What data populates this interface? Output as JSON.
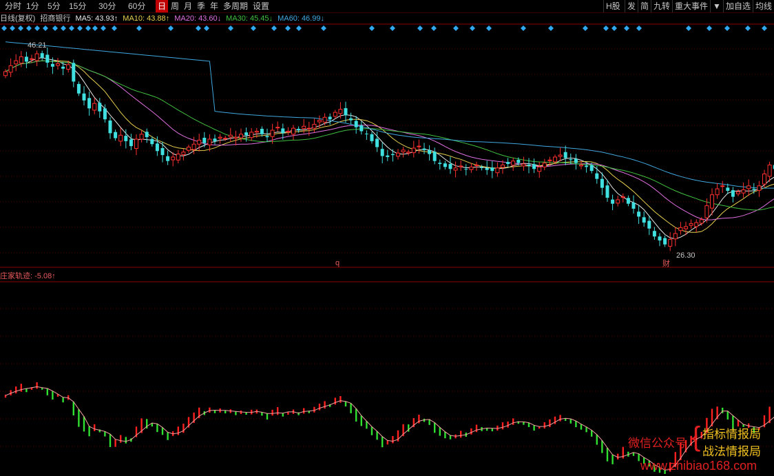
{
  "toolbar": {
    "period_buttons": [
      "分时",
      "1分",
      "5分",
      "15分",
      "30分",
      "60分",
      "日",
      "周",
      "月",
      "季",
      "年",
      "多周期",
      "设置"
    ],
    "active_period": "日",
    "right_buttons": [
      "H股",
      "发",
      "简",
      "九转",
      "重大事件",
      "▼",
      "加自选",
      "均线"
    ]
  },
  "info": {
    "period_label": "日线(复权)",
    "stock_name": "招商银行",
    "ma": [
      {
        "label": "MA5: 43.93↑",
        "color": "#e8e8e8"
      },
      {
        "label": "MA10: 43.88↑",
        "color": "#e8d050"
      },
      {
        "label": "MA20: 43.60↓",
        "color": "#e070e0"
      },
      {
        "label": "MA30: 45.45↓",
        "color": "#40c040"
      },
      {
        "label": "MA60: 46.99↓",
        "color": "#40a8e0"
      }
    ]
  },
  "indicator": {
    "label": "庄家轨迹: -5.08↑"
  },
  "watermark": {
    "left": "微信公众号",
    "right_top": "指标情报局",
    "right_bottom": "战法情报局",
    "url": "www.zhibiao168.com"
  },
  "chart_data": [
    {
      "type": "candlestick",
      "panel": "price",
      "price_range": [
        24.5,
        48.5
      ],
      "annotations": [
        {
          "text": "46.21",
          "note": "high"
        },
        {
          "text": "26.30",
          "note": "low"
        },
        {
          "text": "q",
          "note": "marker"
        },
        {
          "text": "财",
          "note": "marker"
        }
      ],
      "series_names": [
        "MA5",
        "MA10",
        "MA20",
        "MA30",
        "MA60"
      ],
      "close": [
        44.2,
        44.8,
        45.3,
        45.7,
        45.2,
        45.5,
        46.0,
        45.6,
        45.1,
        44.7,
        45.0,
        44.5,
        44.9,
        43.2,
        42.0,
        41.3,
        40.5,
        41.0,
        40.2,
        39.4,
        38.0,
        37.5,
        37.8,
        37.2,
        36.7,
        37.4,
        37.9,
        37.6,
        36.9,
        36.2,
        35.8,
        35.2,
        35.6,
        35.9,
        36.1,
        36.6,
        36.9,
        37.3,
        37.0,
        37.4,
        37.2,
        37.6,
        37.5,
        37.8,
        37.6,
        37.9,
        37.8,
        38.1,
        38.2,
        37.9,
        37.6,
        38.3,
        38.6,
        38.0,
        38.2,
        38.5,
        38.3,
        38.7,
        38.5,
        38.9,
        39.3,
        39.6,
        39.4,
        40.1,
        40.4,
        39.8,
        39.3,
        38.6,
        38.2,
        37.9,
        37.2,
        36.6,
        35.7,
        35.6,
        35.8,
        36.0,
        36.3,
        36.1,
        36.5,
        36.7,
        36.3,
        35.9,
        35.2,
        34.9,
        34.6,
        34.4,
        34.5,
        34.7,
        34.4,
        34.6,
        34.8,
        34.5,
        34.3,
        34.2,
        34.5,
        34.8,
        34.9,
        35.2,
        35.0,
        34.9,
        34.7,
        34.4,
        34.6,
        35.0,
        35.3,
        35.6,
        35.8,
        35.5,
        35.3,
        35.0,
        34.8,
        34.6,
        34.2,
        33.4,
        32.5,
        31.5,
        30.9,
        31.3,
        31.6,
        30.9,
        30.4,
        29.6,
        29.0,
        28.4,
        27.6,
        27.2,
        26.8,
        27.3,
        27.9,
        28.5,
        28.6,
        28.9,
        29.0,
        29.3,
        30.7,
        31.8,
        32.4,
        32.7,
        32.2,
        31.6,
        32.1,
        32.3,
        32.7,
        32.3,
        32.7,
        33.9,
        34.8,
        34.4
      ],
      "ma_values_last": {
        "MA5": 43.93,
        "MA10": 43.88,
        "MA20": 43.6,
        "MA30": 45.45,
        "MA60": 46.99
      }
    },
    {
      "type": "bar",
      "panel": "indicator",
      "name": "庄家轨迹",
      "last_value": -5.08
    }
  ]
}
